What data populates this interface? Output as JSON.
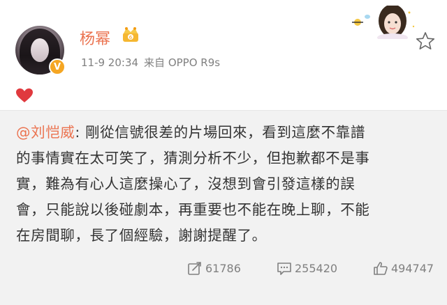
{
  "post": {
    "author": {
      "name": "杨幂",
      "verified_badge": "V",
      "avatar_icon": "avatar-portrait",
      "member_badge_icon": "crown-badge-icon"
    },
    "timestamp": "11-9 20:34",
    "source": "来自 OPPO R9s",
    "reaction_icon": "heart-icon",
    "content": {
      "mention": "@刘恺威",
      "text_lines": [
        ": 剛從信號很差的片場回來，看到這麼不靠譜",
        "的事情實在太可笑了，猜測分析不少，但抱歉都不是事",
        "實，難為有心人這麼操心了，沒想到會引發這樣的誤",
        "會，只能說以後碰劇本，再重要也不能在晚上聊，不能",
        "在房間聊，長了個經驗，謝謝提醒了。"
      ]
    },
    "actions": {
      "repost_count": "61786",
      "comment_count": "255420",
      "like_count": "494747"
    }
  },
  "colors": {
    "accent": "#eb7350",
    "verified": "#f5a623",
    "muted_text": "#808080",
    "body_bg": "#f2f2f2",
    "heart": "#e0393e"
  }
}
